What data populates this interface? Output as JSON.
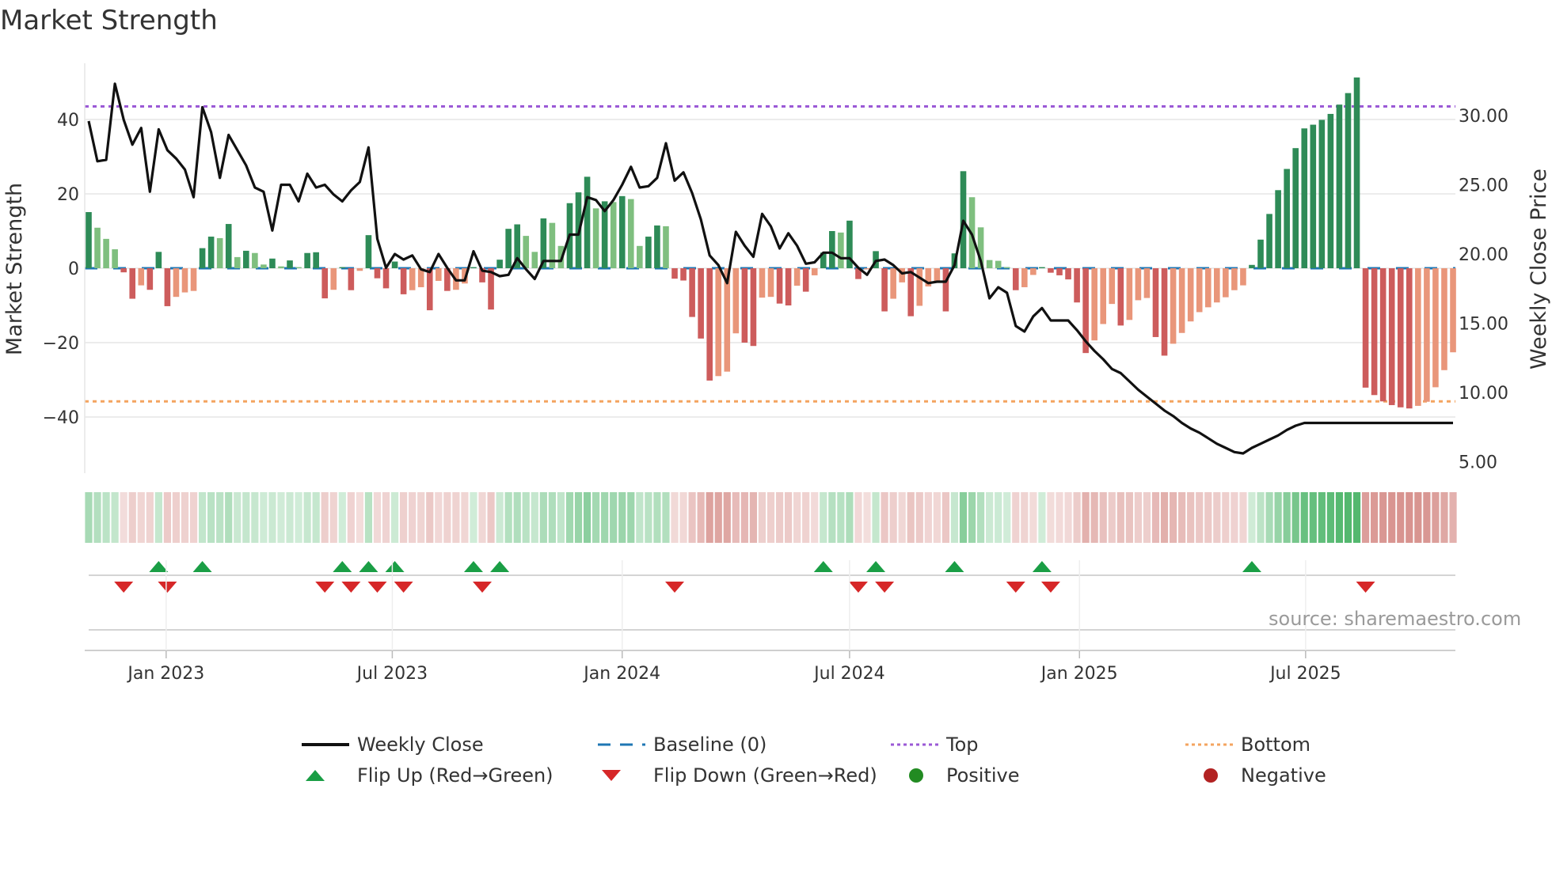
{
  "title": "Market Strength",
  "source": "source: sharemaestro.com",
  "legend": {
    "weekly_close": "Weekly Close",
    "baseline": "Baseline (0)",
    "top": "Top",
    "bottom": "Bottom",
    "flip_up": "Flip Up (Red→Green)",
    "flip_down": "Flip Down (Green→Red)",
    "positive": "Positive",
    "negative": "Negative"
  },
  "colors": {
    "pos_strong": "#2e8b57",
    "pos_weak": "#7fbf7f",
    "neg_strong": "#cd5c5c",
    "neg_weak": "#e9967a",
    "baseline": "#1f77b4",
    "top": "#9b59d6",
    "bottom": "#f4a460",
    "flip_up": "#1a9e45",
    "flip_down": "#d62728",
    "positive": "#228b22",
    "negative": "#b22222",
    "close": "#111111"
  },
  "chart_data": {
    "type": "bar",
    "title": "Market Strength",
    "ylabel": "Market Strength",
    "y2label": "Weekly Close Price",
    "start_date": "2022-10-31",
    "interval_days": 7,
    "ylim": [
      -55,
      55
    ],
    "y2lim": [
      3.3,
      33.9
    ],
    "yticks": [
      40,
      20,
      0,
      -20,
      -40
    ],
    "ytick_labels": [
      "40",
      "20",
      "0",
      "−20",
      "−40"
    ],
    "y2ticks": [
      30,
      25,
      20,
      15,
      10,
      5
    ],
    "y2tick_labels": [
      "30.00",
      "25.00",
      "20.00",
      "15.00",
      "10.00",
      "5.00"
    ],
    "xticks": [
      "2023-01-01",
      "2023-07-01",
      "2024-01-01",
      "2024-07-01",
      "2025-01-01",
      "2025-07-01"
    ],
    "xtick_labels": [
      "Jan 2023",
      "Jul 2023",
      "Jan 2024",
      "Jul 2024",
      "Jan 2025",
      "Jul 2025"
    ],
    "top_level": 43.5,
    "bottom_level": -35.8,
    "baseline": 0,
    "grid": true,
    "legend_placement": "bottom",
    "strength": [
      15.1,
      10.9,
      7.9,
      5.1,
      -1.1,
      -8.2,
      -4.6,
      -5.8,
      4.4,
      -10.2,
      -7.7,
      -6.5,
      -6.1,
      5.4,
      8.5,
      8.1,
      11.9,
      3.0,
      4.7,
      4.1,
      1.0,
      2.6,
      0.5,
      2.1,
      0.3,
      4.1,
      4.3,
      -8.1,
      -5.8,
      0.3,
      -5.9,
      -0.7,
      8.9,
      -2.7,
      -5.4,
      1.8,
      -7.0,
      -5.9,
      -5.1,
      -11.3,
      -3.4,
      -6.1,
      -5.8,
      -4.1,
      0.3,
      -3.8,
      -11.1,
      2.3,
      10.6,
      11.8,
      8.7,
      4.4,
      13.4,
      12.2,
      6.0,
      17.5,
      20.4,
      24.6,
      16.1,
      18.0,
      17.8,
      19.4,
      18.6,
      6.0,
      8.5,
      11.5,
      11.3,
      -2.8,
      -3.3,
      -13.1,
      -18.9,
      -30.2,
      -29.0,
      -27.8,
      -17.5,
      -20.0,
      -20.9,
      -7.9,
      -7.7,
      -9.5,
      -10.0,
      -4.7,
      -6.3,
      -1.9,
      4.2,
      10.0,
      9.6,
      12.8,
      -2.9,
      -0.3,
      4.6,
      -11.6,
      -8.2,
      -3.8,
      -12.9,
      -10.1,
      -4.9,
      -3.6,
      -11.6,
      4.0,
      26.1,
      19.1,
      11.0,
      2.2,
      2.0,
      0.3,
      -5.9,
      -5.1,
      -1.8,
      0.3,
      -1.2,
      -1.9,
      -3.0,
      -9.2,
      -22.8,
      -19.4,
      -15.0,
      -9.6,
      -15.4,
      -13.9,
      -8.6,
      -8.0,
      -18.5,
      -23.5,
      -20.3,
      -17.4,
      -14.3,
      -11.8,
      -10.5,
      -9.2,
      -7.8,
      -5.9,
      -4.6,
      0.9,
      7.7,
      14.6,
      21.0,
      26.7,
      32.3,
      37.6,
      38.6,
      39.9,
      41.5,
      44.0,
      47.1,
      51.3,
      -32.1,
      -34.1,
      -35.8,
      -36.8,
      -37.4,
      -37.7,
      -37.0,
      -35.9,
      -32.0,
      -27.4,
      -22.6
    ],
    "weekly_close": [
      29.6,
      26.7,
      26.8,
      32.3,
      29.7,
      27.9,
      29.1,
      24.5,
      29.0,
      27.5,
      26.9,
      26.1,
      24.1,
      30.6,
      28.8,
      25.5,
      28.6,
      27.5,
      26.4,
      24.8,
      24.5,
      21.7,
      25.0,
      25.0,
      23.8,
      25.8,
      24.8,
      25.0,
      24.3,
      23.8,
      24.6,
      25.2,
      27.7,
      21.1,
      19.0,
      20.0,
      19.6,
      19.9,
      18.9,
      18.7,
      20.0,
      19.0,
      18.1,
      18.1,
      20.2,
      18.8,
      18.7,
      18.4,
      18.5,
      19.7,
      18.9,
      18.2,
      19.5,
      19.5,
      19.5,
      21.4,
      21.4,
      24.1,
      23.9,
      23.1,
      23.9,
      25.0,
      26.3,
      24.8,
      24.9,
      25.5,
      28.0,
      25.3,
      25.9,
      24.4,
      22.5,
      19.9,
      19.2,
      17.9,
      21.6,
      20.6,
      19.8,
      22.9,
      22.0,
      20.4,
      21.5,
      20.6,
      19.3,
      19.4,
      20.1,
      20.1,
      19.7,
      19.7,
      19.0,
      18.5,
      19.5,
      19.6,
      19.2,
      18.6,
      18.7,
      18.3,
      17.9,
      18.0,
      18.0,
      19.2,
      22.4,
      21.4,
      19.5,
      16.8,
      17.6,
      17.2,
      14.8,
      14.4,
      15.5,
      16.1,
      15.2,
      15.2,
      15.2,
      14.5,
      13.7,
      13.0,
      12.4,
      11.7,
      11.4,
      10.8,
      10.2,
      9.7,
      9.2,
      8.7,
      8.3,
      7.8,
      7.4,
      7.1,
      6.7,
      6.3,
      6.0,
      5.7,
      5.6,
      6.0,
      6.3,
      6.6,
      6.9,
      7.3,
      7.6,
      7.8,
      7.8,
      7.8,
      7.8,
      7.8,
      7.8,
      7.8,
      7.8,
      7.8,
      7.8,
      7.8,
      7.8,
      7.8,
      7.8,
      7.8,
      7.8,
      7.8,
      7.8
    ]
  }
}
